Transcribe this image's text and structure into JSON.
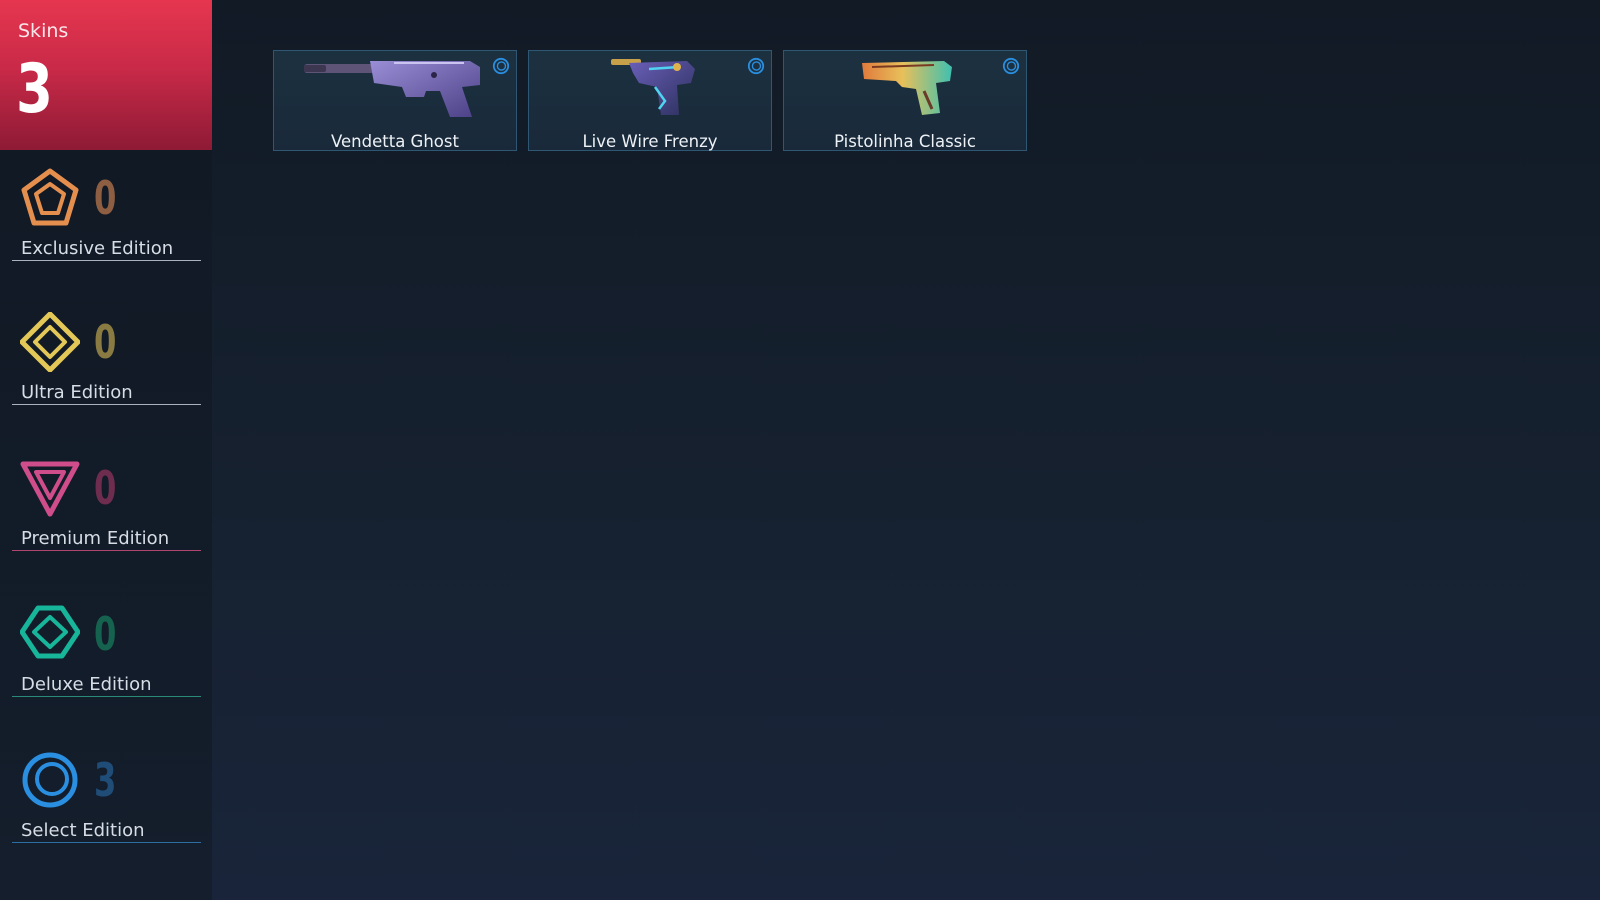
{
  "header": {
    "label": "Skins",
    "count": "3"
  },
  "editions": [
    {
      "name": "Exclusive Edition",
      "count": "0",
      "icon": "exclusive-edition-icon",
      "color": "#e58f4f",
      "count_color": "#8e5e43",
      "rule_color": "#a9b2bd"
    },
    {
      "name": "Ultra Edition",
      "count": "0",
      "icon": "ultra-edition-icon",
      "color": "#e3c857",
      "count_color": "#8a7b42",
      "rule_color": "#a9b2bd"
    },
    {
      "name": "Premium Edition",
      "count": "0",
      "icon": "premium-edition-icon",
      "color": "#cf4d8a",
      "count_color": "#6e2d4e",
      "rule_color": "#b0466f"
    },
    {
      "name": "Deluxe Edition",
      "count": "0",
      "icon": "deluxe-edition-icon",
      "color": "#17b59a",
      "count_color": "#15634f",
      "rule_color": "#2a8a78"
    },
    {
      "name": "Select Edition",
      "count": "3",
      "icon": "select-edition-icon",
      "color": "#2a8fe0",
      "count_color": "#1f4d78",
      "rule_color": "#2d6ea3"
    }
  ],
  "skins": [
    {
      "name": "Vendetta Ghost",
      "tier_icon": "select-edition-icon"
    },
    {
      "name": "Live Wire Frenzy",
      "tier_icon": "select-edition-icon"
    },
    {
      "name": "Pistolinha Classic",
      "tier_icon": "select-edition-icon"
    }
  ]
}
